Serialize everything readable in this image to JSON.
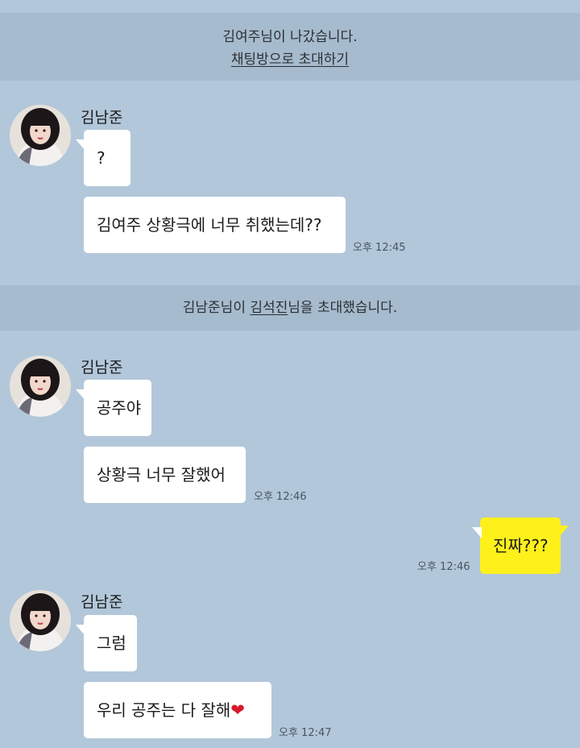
{
  "notices": [
    {
      "line1": "김여주님이 나갔습니다.",
      "line2": "채팅방으로 초대하기"
    },
    {
      "prefix": "김남준님이 ",
      "name": "김석진",
      "suffix": "님을 초대했습니다."
    }
  ],
  "groups": [
    {
      "sender": "김남준",
      "messages": [
        "?",
        "김여주 상황극에 너무 취했는데??"
      ],
      "time": "오후 12:45"
    },
    {
      "sender": "김남준",
      "messages": [
        "공주야",
        "상황극 너무 잘했어"
      ],
      "time": "오후 12:46"
    },
    {
      "sender": "김남준",
      "messages": [
        "그럼",
        "우리 공주는 다 잘해"
      ],
      "time": "오후 12:47"
    }
  ],
  "my_message": {
    "text": "진짜???",
    "time": "오후 12:46"
  },
  "colors": {
    "background": "#b2c7da",
    "notice_band": "#a6bbcd",
    "my_bubble": "#fef01b",
    "other_bubble": "#ffffff",
    "heart": "#d8172b"
  },
  "icons": {
    "heart": "heart-icon"
  }
}
